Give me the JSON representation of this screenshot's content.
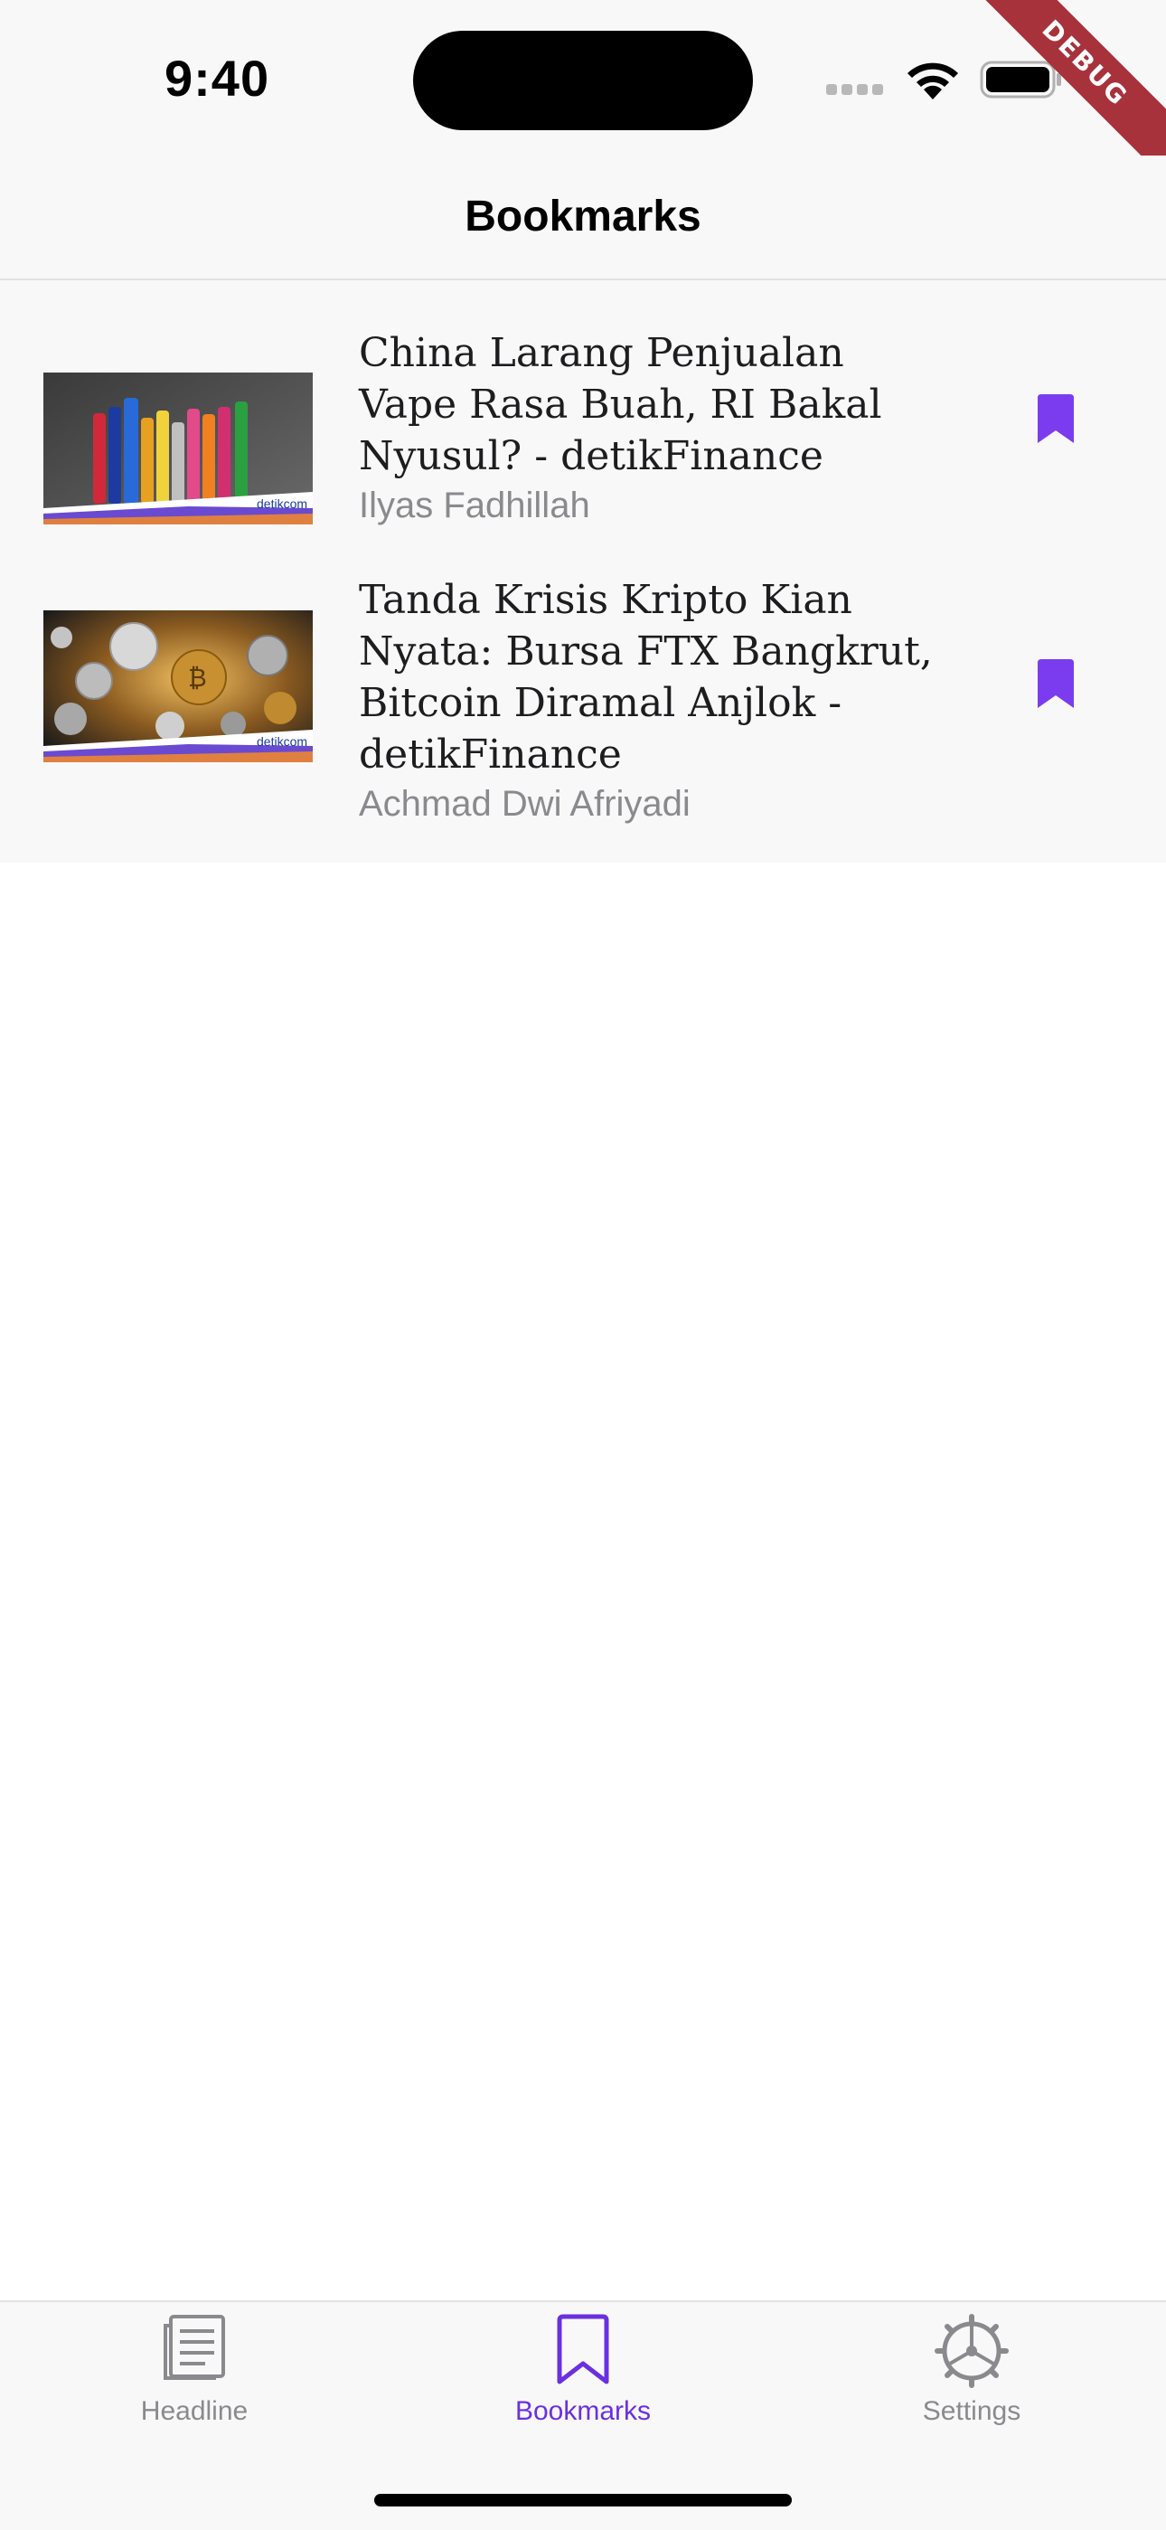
{
  "status": {
    "time": "9:40"
  },
  "debug_banner": "DEBUG",
  "nav": {
    "title": "Bookmarks"
  },
  "articles": [
    {
      "title": "China Larang Penjualan Vape Rasa Buah, RI Bakal Nyusul? - detikFinance",
      "author": "Ilyas Fadhillah",
      "thumb_brand": "detikcom",
      "bookmarked": true
    },
    {
      "title": "Tanda Krisis Kripto Kian Nyata: Bursa FTX Bangkrut, Bitcoin Diramal Anjlok - detikFinance",
      "author": "Achmad Dwi Afriyadi",
      "thumb_brand": "detikcom",
      "bookmarked": true
    }
  ],
  "tabs": [
    {
      "label": "Headline",
      "icon": "newspaper-icon",
      "active": false
    },
    {
      "label": "Bookmarks",
      "icon": "bookmark-icon",
      "active": true
    },
    {
      "label": "Settings",
      "icon": "gear-icon",
      "active": false
    }
  ],
  "colors": {
    "accent": "#6a30e0",
    "bookmark": "#7b3cf0",
    "inactive": "#8a8a8e"
  }
}
